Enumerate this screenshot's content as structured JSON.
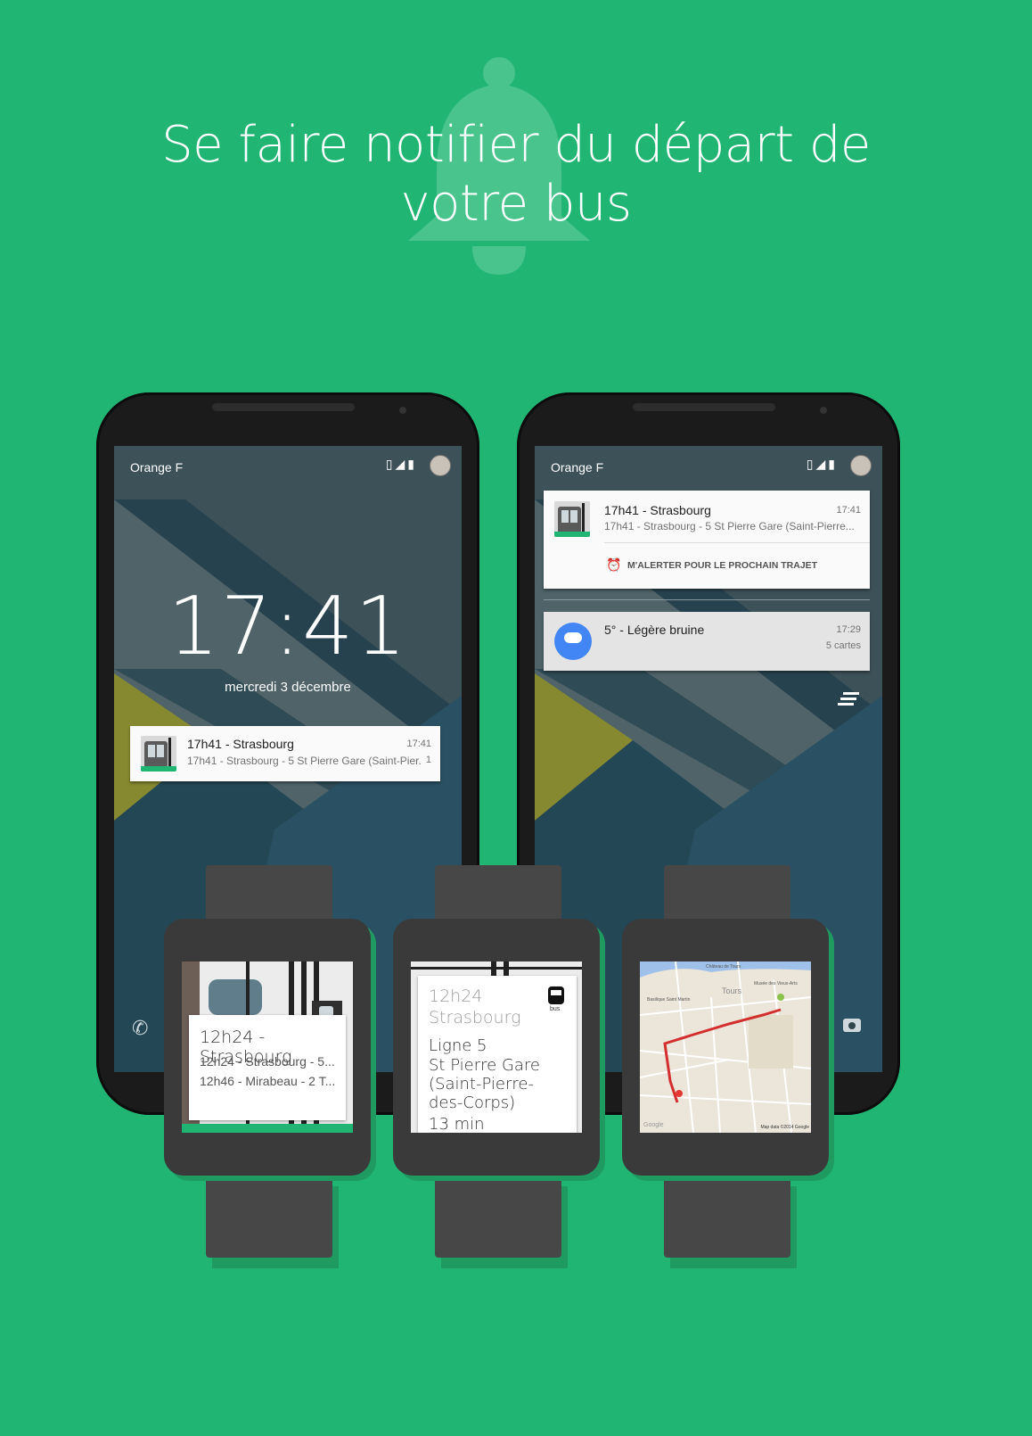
{
  "headline": "Se faire notifier du départ de votre bus",
  "headline_lines": [
    "Se faire notifier du départ de",
    "votre bus"
  ],
  "colors": {
    "background": "#21b573",
    "accent_blue": "#4285f4",
    "route_red": "#d32f2f"
  },
  "phone_left": {
    "carrier": "Orange F",
    "status_icons": [
      "vibrate-icon",
      "signal-h-icon",
      "battery-icon",
      "avatar"
    ],
    "clock": "17:41",
    "date": "mercredi 3 décembre",
    "notification": {
      "title": "17h41 - Strasbourg",
      "time": "17:41",
      "subtitle": "17h41 - Strasbourg - 5 St Pierre Gare (Saint-Pier..",
      "count": "1"
    },
    "bottom_left_icon": "phone-icon"
  },
  "phone_right": {
    "carrier": "Orange F",
    "notification_bus": {
      "title": "17h41 - Strasbourg",
      "time": "17:41",
      "subtitle": "17h41 - Strasbourg - 5 St Pierre Gare (Saint-Pierre...",
      "action": "M'ALERTER POUR LE PROCHAIN TRAJET"
    },
    "notification_weather": {
      "title": "5° - Légère bruine",
      "time": "17:29",
      "cards": "5 cartes"
    },
    "bottom_right_icon": "camera-icon"
  },
  "watch_1": {
    "title": "12h24 - Strasbourg",
    "line1": "12h24 - Strasbourg - 5...",
    "line2": "12h46 - Mirabeau - 2 T..."
  },
  "watch_2": {
    "time": "12h24",
    "destination": "Strasbourg",
    "line": "Ligne 5",
    "stop": "St Pierre Gare (Saint-Pierre-des-Corps)",
    "wait": "13 min",
    "bus_label": "bus"
  },
  "watch_3": {
    "map_label_1": "Tours",
    "map_label_2": "Basilique Saint Martin",
    "map_label_3": "Musée des Vieux-Arts",
    "map_label_4": "Château de Tours",
    "map_credit_left": "Google",
    "map_credit_right": "Map data ©2014 Google"
  }
}
